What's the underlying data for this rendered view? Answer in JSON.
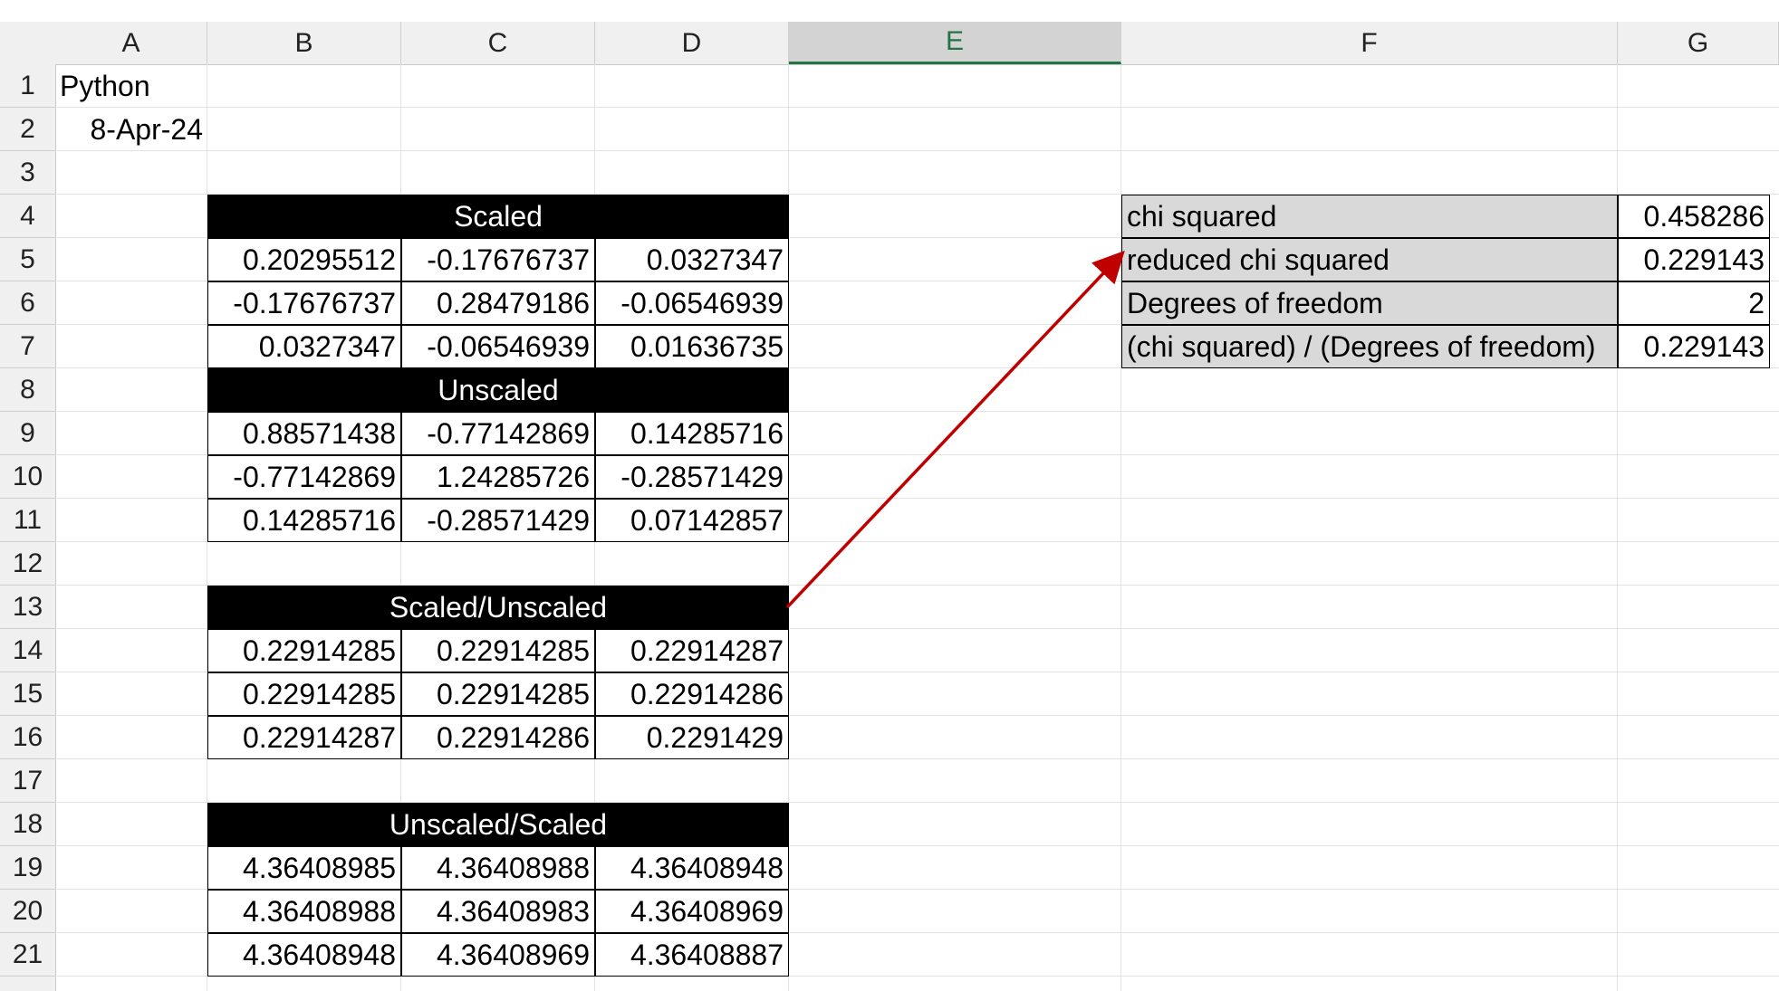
{
  "columns": [
    "A",
    "B",
    "C",
    "D",
    "E",
    "F",
    "G"
  ],
  "selected_column": "E",
  "rows": [
    "1",
    "2",
    "3",
    "4",
    "5",
    "6",
    "7",
    "8",
    "9",
    "10",
    "11",
    "12",
    "13",
    "14",
    "15",
    "16",
    "17",
    "18",
    "19",
    "20",
    "21"
  ],
  "cells": {
    "a1": "Python",
    "a2": "8-Apr-24"
  },
  "scaled": {
    "title": "Scaled",
    "values": [
      [
        "0.20295512",
        "-0.17676737",
        "0.0327347"
      ],
      [
        "-0.17676737",
        "0.28479186",
        "-0.06546939"
      ],
      [
        "0.0327347",
        "-0.06546939",
        "0.01636735"
      ]
    ]
  },
  "unscaled": {
    "title": "Unscaled",
    "values": [
      [
        "0.88571438",
        "-0.77142869",
        "0.14285716"
      ],
      [
        "-0.77142869",
        "1.24285726",
        "-0.28571429"
      ],
      [
        "0.14285716",
        "-0.28571429",
        "0.07142857"
      ]
    ]
  },
  "scaled_unscaled": {
    "title": "Scaled/Unscaled",
    "values": [
      [
        "0.22914285",
        "0.22914285",
        "0.22914287"
      ],
      [
        "0.22914285",
        "0.22914285",
        "0.22914286"
      ],
      [
        "0.22914287",
        "0.22914286",
        "0.2291429"
      ]
    ]
  },
  "unscaled_scaled": {
    "title": "Unscaled/Scaled",
    "values": [
      [
        "4.36408985",
        "4.36408988",
        "4.36408948"
      ],
      [
        "4.36408988",
        "4.36408983",
        "4.36408969"
      ],
      [
        "4.36408948",
        "4.36408969",
        "4.36408887"
      ]
    ]
  },
  "stats": [
    {
      "label": "chi squared",
      "value": "0.458286"
    },
    {
      "label": "reduced chi squared",
      "value": "0.229143"
    },
    {
      "label": "Degrees of freedom",
      "value": "2"
    },
    {
      "label": "(chi squared) / (Degrees of freedom)",
      "value": "0.229143"
    }
  ],
  "colors": {
    "arrow": "#c00000",
    "selected_column_accent": "#217346",
    "stats_label_fill": "#d9d9d9"
  }
}
